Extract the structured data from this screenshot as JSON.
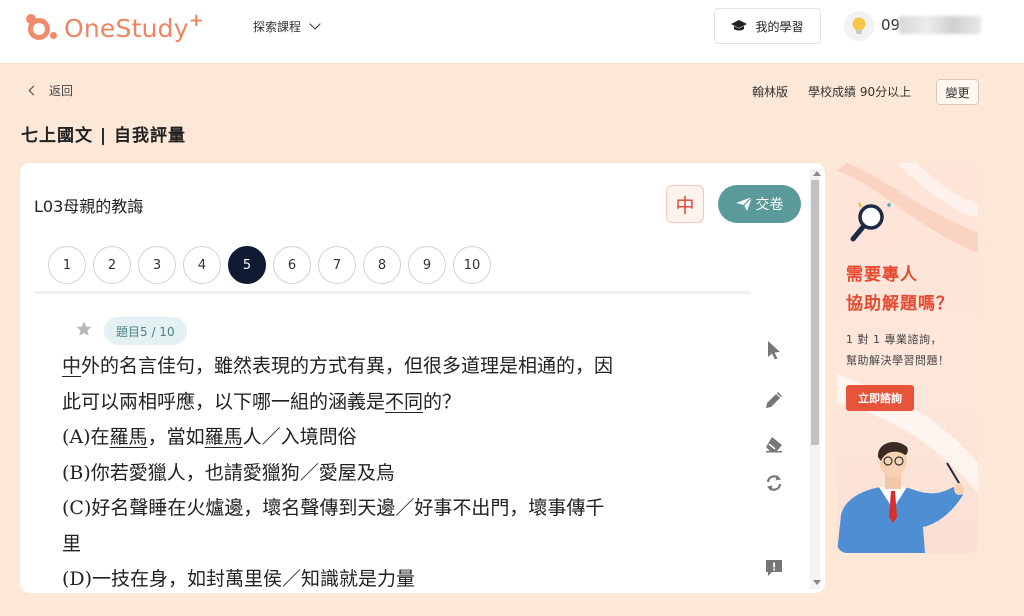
{
  "header": {
    "brand": "OneStudy",
    "brand_plus": "+",
    "explore_label": "探索課程",
    "my_learning_label": "我的學習",
    "username": "09"
  },
  "subbar": {
    "back_label": "返回",
    "edition": "翰林版",
    "grade_level": "學校成績 90分以上",
    "change_label": "變更"
  },
  "page_title": "七上國文 | 自我評量",
  "quiz": {
    "lesson": "L03母親的教誨",
    "font_size_label": "中",
    "submit_label": "交卷",
    "question_numbers": [
      "1",
      "2",
      "3",
      "4",
      "5",
      "6",
      "7",
      "8",
      "9",
      "10"
    ],
    "current_question": "5",
    "counter": "題目5 / 10",
    "question_lines": [
      {
        "segments": [
          {
            "t": "中",
            "u": true
          },
          {
            "t": "外的名言佳句，雖然表現的方式有異，但很多道理是相通的，因",
            "u": false
          }
        ]
      },
      {
        "segments": [
          {
            "t": "此可以兩相呼應，以下哪一組的涵義是",
            "u": false
          },
          {
            "t": "不同",
            "u": true
          },
          {
            "t": "的？",
            "u": false
          }
        ]
      },
      {
        "segments": [
          {
            "t": "(A)在",
            "u": false
          },
          {
            "t": "羅馬",
            "u": true
          },
          {
            "t": "，當如",
            "u": false
          },
          {
            "t": "羅馬",
            "u": true
          },
          {
            "t": "人／入境問俗",
            "u": false
          }
        ]
      },
      {
        "segments": [
          {
            "t": "(B)你若愛獵人，也請愛獵狗／愛屋及烏",
            "u": false
          }
        ]
      },
      {
        "segments": [
          {
            "t": "(C)好名聲睡在火爐邊，壞名聲傳到天邊／好事不出門，壞事傳千",
            "u": false
          }
        ]
      },
      {
        "segments": [
          {
            "t": "里",
            "u": false
          }
        ]
      },
      {
        "segments": [
          {
            "t": "(D)一技在身，如封萬里侯／知識就是力量",
            "u": false
          }
        ]
      }
    ]
  },
  "tools": [
    "pointer-icon",
    "pencil-icon",
    "eraser-icon",
    "refresh-icon",
    "report-icon"
  ],
  "ad": {
    "headline_line1": "需要專人",
    "headline_line2": "協助解題嗎？",
    "sub_line1": "1 對 1 專業諮詢，",
    "sub_line2": "幫助解決學習問題！",
    "cta_label": "立即諮詢"
  },
  "colors": {
    "page_bg": "#fde8d7",
    "brand": "#ee8560",
    "submit": "#5a9a9a",
    "active_question": "#111a33",
    "ad_accent": "#e64a31"
  }
}
